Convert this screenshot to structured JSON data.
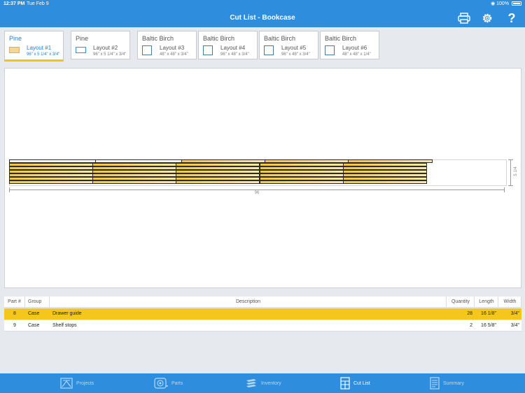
{
  "status_bar": {
    "time": "12:37 PM",
    "date": "Tue Feb 9",
    "battery": "100%"
  },
  "nav": {
    "title": "Cut List - Bookcase",
    "print_icon": "printer-icon",
    "settings_icon": "gear-icon",
    "help_label": "?"
  },
  "layouts": [
    {
      "material": "Pine",
      "label": "Layout #1",
      "dims": "96\" x 5 1/4\" x  3/4\"",
      "active": true
    },
    {
      "material": "Pine",
      "label": "Layout #2",
      "dims": "96\" x 5 1/4\" x  3/4\"",
      "active": false
    },
    {
      "material": "Baltic Birch",
      "label": "Layout #3",
      "dims": "48\" x 48\" x  3/4\"",
      "active": false
    },
    {
      "material": "Baltic Birch",
      "label": "Layout #4",
      "dims": "96\" x 48\" x  3/4\"",
      "active": false
    },
    {
      "material": "Baltic Birch",
      "label": "Layout #5",
      "dims": "96\" x 48\" x  3/4\"",
      "active": false
    },
    {
      "material": "Baltic Birch",
      "label": "Layout #6",
      "dims": "48\" x 48\" x  1/4\"",
      "active": false
    }
  ],
  "board": {
    "length_label": "96",
    "width_label": "5 1/4"
  },
  "table": {
    "headers": {
      "part": "Part #",
      "group": "Group",
      "description": "Description",
      "quantity": "Quantity",
      "length": "Length",
      "width": "Width"
    },
    "rows": [
      {
        "part": "8",
        "group": "Case",
        "description": "Drawer guide",
        "quantity": "28",
        "length": "16 1/8\"",
        "width": "3/4\"",
        "selected": true
      },
      {
        "part": "9",
        "group": "Case",
        "description": "Shelf stops",
        "quantity": "2",
        "length": "16 5/8\"",
        "width": "3/4\"",
        "selected": false
      }
    ]
  },
  "tabbar": [
    {
      "label": "Projects",
      "icon": "projects-icon",
      "active": false
    },
    {
      "label": "Parts",
      "icon": "tape-measure-icon",
      "active": false
    },
    {
      "label": "Inventory",
      "icon": "lumber-stack-icon",
      "active": false
    },
    {
      "label": "Cut List",
      "icon": "cut-list-icon",
      "active": true
    },
    {
      "label": "Summary",
      "icon": "summary-icon",
      "active": false
    }
  ]
}
